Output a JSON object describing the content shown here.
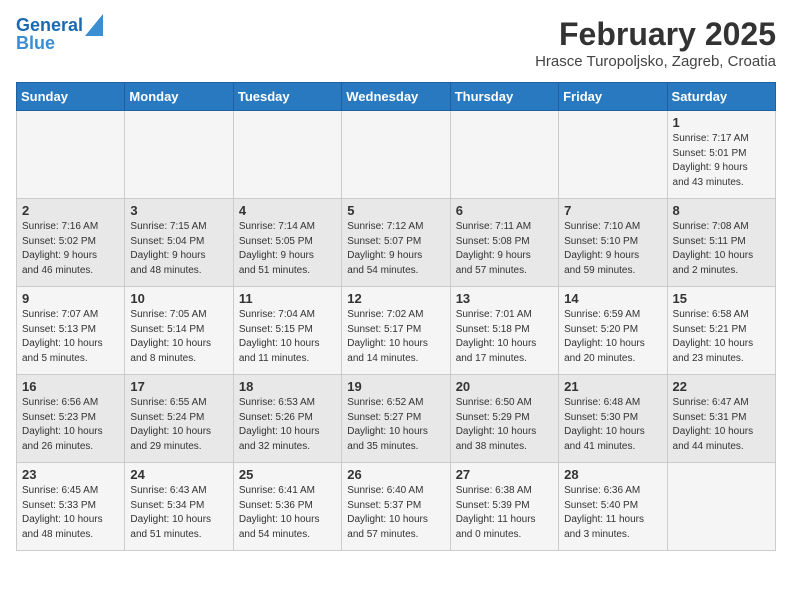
{
  "header": {
    "logo_line1": "General",
    "logo_line2": "Blue",
    "month": "February 2025",
    "location": "Hrasce Turopoljsko, Zagreb, Croatia"
  },
  "weekdays": [
    "Sunday",
    "Monday",
    "Tuesday",
    "Wednesday",
    "Thursday",
    "Friday",
    "Saturday"
  ],
  "weeks": [
    [
      {
        "day": "",
        "info": ""
      },
      {
        "day": "",
        "info": ""
      },
      {
        "day": "",
        "info": ""
      },
      {
        "day": "",
        "info": ""
      },
      {
        "day": "",
        "info": ""
      },
      {
        "day": "",
        "info": ""
      },
      {
        "day": "1",
        "info": "Sunrise: 7:17 AM\nSunset: 5:01 PM\nDaylight: 9 hours\nand 43 minutes."
      }
    ],
    [
      {
        "day": "2",
        "info": "Sunrise: 7:16 AM\nSunset: 5:02 PM\nDaylight: 9 hours\nand 46 minutes."
      },
      {
        "day": "3",
        "info": "Sunrise: 7:15 AM\nSunset: 5:04 PM\nDaylight: 9 hours\nand 48 minutes."
      },
      {
        "day": "4",
        "info": "Sunrise: 7:14 AM\nSunset: 5:05 PM\nDaylight: 9 hours\nand 51 minutes."
      },
      {
        "day": "5",
        "info": "Sunrise: 7:12 AM\nSunset: 5:07 PM\nDaylight: 9 hours\nand 54 minutes."
      },
      {
        "day": "6",
        "info": "Sunrise: 7:11 AM\nSunset: 5:08 PM\nDaylight: 9 hours\nand 57 minutes."
      },
      {
        "day": "7",
        "info": "Sunrise: 7:10 AM\nSunset: 5:10 PM\nDaylight: 9 hours\nand 59 minutes."
      },
      {
        "day": "8",
        "info": "Sunrise: 7:08 AM\nSunset: 5:11 PM\nDaylight: 10 hours\nand 2 minutes."
      }
    ],
    [
      {
        "day": "9",
        "info": "Sunrise: 7:07 AM\nSunset: 5:13 PM\nDaylight: 10 hours\nand 5 minutes."
      },
      {
        "day": "10",
        "info": "Sunrise: 7:05 AM\nSunset: 5:14 PM\nDaylight: 10 hours\nand 8 minutes."
      },
      {
        "day": "11",
        "info": "Sunrise: 7:04 AM\nSunset: 5:15 PM\nDaylight: 10 hours\nand 11 minutes."
      },
      {
        "day": "12",
        "info": "Sunrise: 7:02 AM\nSunset: 5:17 PM\nDaylight: 10 hours\nand 14 minutes."
      },
      {
        "day": "13",
        "info": "Sunrise: 7:01 AM\nSunset: 5:18 PM\nDaylight: 10 hours\nand 17 minutes."
      },
      {
        "day": "14",
        "info": "Sunrise: 6:59 AM\nSunset: 5:20 PM\nDaylight: 10 hours\nand 20 minutes."
      },
      {
        "day": "15",
        "info": "Sunrise: 6:58 AM\nSunset: 5:21 PM\nDaylight: 10 hours\nand 23 minutes."
      }
    ],
    [
      {
        "day": "16",
        "info": "Sunrise: 6:56 AM\nSunset: 5:23 PM\nDaylight: 10 hours\nand 26 minutes."
      },
      {
        "day": "17",
        "info": "Sunrise: 6:55 AM\nSunset: 5:24 PM\nDaylight: 10 hours\nand 29 minutes."
      },
      {
        "day": "18",
        "info": "Sunrise: 6:53 AM\nSunset: 5:26 PM\nDaylight: 10 hours\nand 32 minutes."
      },
      {
        "day": "19",
        "info": "Sunrise: 6:52 AM\nSunset: 5:27 PM\nDaylight: 10 hours\nand 35 minutes."
      },
      {
        "day": "20",
        "info": "Sunrise: 6:50 AM\nSunset: 5:29 PM\nDaylight: 10 hours\nand 38 minutes."
      },
      {
        "day": "21",
        "info": "Sunrise: 6:48 AM\nSunset: 5:30 PM\nDaylight: 10 hours\nand 41 minutes."
      },
      {
        "day": "22",
        "info": "Sunrise: 6:47 AM\nSunset: 5:31 PM\nDaylight: 10 hours\nand 44 minutes."
      }
    ],
    [
      {
        "day": "23",
        "info": "Sunrise: 6:45 AM\nSunset: 5:33 PM\nDaylight: 10 hours\nand 48 minutes."
      },
      {
        "day": "24",
        "info": "Sunrise: 6:43 AM\nSunset: 5:34 PM\nDaylight: 10 hours\nand 51 minutes."
      },
      {
        "day": "25",
        "info": "Sunrise: 6:41 AM\nSunset: 5:36 PM\nDaylight: 10 hours\nand 54 minutes."
      },
      {
        "day": "26",
        "info": "Sunrise: 6:40 AM\nSunset: 5:37 PM\nDaylight: 10 hours\nand 57 minutes."
      },
      {
        "day": "27",
        "info": "Sunrise: 6:38 AM\nSunset: 5:39 PM\nDaylight: 11 hours\nand 0 minutes."
      },
      {
        "day": "28",
        "info": "Sunrise: 6:36 AM\nSunset: 5:40 PM\nDaylight: 11 hours\nand 3 minutes."
      },
      {
        "day": "",
        "info": ""
      }
    ]
  ]
}
